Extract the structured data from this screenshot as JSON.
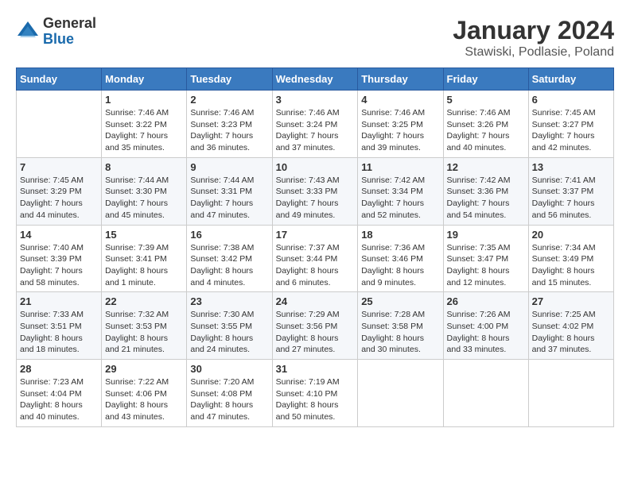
{
  "logo": {
    "general": "General",
    "blue": "Blue"
  },
  "title": {
    "month_year": "January 2024",
    "location": "Stawiski, Podlasie, Poland"
  },
  "days_of_week": [
    "Sunday",
    "Monday",
    "Tuesday",
    "Wednesday",
    "Thursday",
    "Friday",
    "Saturday"
  ],
  "weeks": [
    [
      {
        "day": "",
        "info": ""
      },
      {
        "day": "1",
        "info": "Sunrise: 7:46 AM\nSunset: 3:22 PM\nDaylight: 7 hours\nand 35 minutes."
      },
      {
        "day": "2",
        "info": "Sunrise: 7:46 AM\nSunset: 3:23 PM\nDaylight: 7 hours\nand 36 minutes."
      },
      {
        "day": "3",
        "info": "Sunrise: 7:46 AM\nSunset: 3:24 PM\nDaylight: 7 hours\nand 37 minutes."
      },
      {
        "day": "4",
        "info": "Sunrise: 7:46 AM\nSunset: 3:25 PM\nDaylight: 7 hours\nand 39 minutes."
      },
      {
        "day": "5",
        "info": "Sunrise: 7:46 AM\nSunset: 3:26 PM\nDaylight: 7 hours\nand 40 minutes."
      },
      {
        "day": "6",
        "info": "Sunrise: 7:45 AM\nSunset: 3:27 PM\nDaylight: 7 hours\nand 42 minutes."
      }
    ],
    [
      {
        "day": "7",
        "info": "Sunrise: 7:45 AM\nSunset: 3:29 PM\nDaylight: 7 hours\nand 44 minutes."
      },
      {
        "day": "8",
        "info": "Sunrise: 7:44 AM\nSunset: 3:30 PM\nDaylight: 7 hours\nand 45 minutes."
      },
      {
        "day": "9",
        "info": "Sunrise: 7:44 AM\nSunset: 3:31 PM\nDaylight: 7 hours\nand 47 minutes."
      },
      {
        "day": "10",
        "info": "Sunrise: 7:43 AM\nSunset: 3:33 PM\nDaylight: 7 hours\nand 49 minutes."
      },
      {
        "day": "11",
        "info": "Sunrise: 7:42 AM\nSunset: 3:34 PM\nDaylight: 7 hours\nand 52 minutes."
      },
      {
        "day": "12",
        "info": "Sunrise: 7:42 AM\nSunset: 3:36 PM\nDaylight: 7 hours\nand 54 minutes."
      },
      {
        "day": "13",
        "info": "Sunrise: 7:41 AM\nSunset: 3:37 PM\nDaylight: 7 hours\nand 56 minutes."
      }
    ],
    [
      {
        "day": "14",
        "info": "Sunrise: 7:40 AM\nSunset: 3:39 PM\nDaylight: 7 hours\nand 58 minutes."
      },
      {
        "day": "15",
        "info": "Sunrise: 7:39 AM\nSunset: 3:41 PM\nDaylight: 8 hours\nand 1 minute."
      },
      {
        "day": "16",
        "info": "Sunrise: 7:38 AM\nSunset: 3:42 PM\nDaylight: 8 hours\nand 4 minutes."
      },
      {
        "day": "17",
        "info": "Sunrise: 7:37 AM\nSunset: 3:44 PM\nDaylight: 8 hours\nand 6 minutes."
      },
      {
        "day": "18",
        "info": "Sunrise: 7:36 AM\nSunset: 3:46 PM\nDaylight: 8 hours\nand 9 minutes."
      },
      {
        "day": "19",
        "info": "Sunrise: 7:35 AM\nSunset: 3:47 PM\nDaylight: 8 hours\nand 12 minutes."
      },
      {
        "day": "20",
        "info": "Sunrise: 7:34 AM\nSunset: 3:49 PM\nDaylight: 8 hours\nand 15 minutes."
      }
    ],
    [
      {
        "day": "21",
        "info": "Sunrise: 7:33 AM\nSunset: 3:51 PM\nDaylight: 8 hours\nand 18 minutes."
      },
      {
        "day": "22",
        "info": "Sunrise: 7:32 AM\nSunset: 3:53 PM\nDaylight: 8 hours\nand 21 minutes."
      },
      {
        "day": "23",
        "info": "Sunrise: 7:30 AM\nSunset: 3:55 PM\nDaylight: 8 hours\nand 24 minutes."
      },
      {
        "day": "24",
        "info": "Sunrise: 7:29 AM\nSunset: 3:56 PM\nDaylight: 8 hours\nand 27 minutes."
      },
      {
        "day": "25",
        "info": "Sunrise: 7:28 AM\nSunset: 3:58 PM\nDaylight: 8 hours\nand 30 minutes."
      },
      {
        "day": "26",
        "info": "Sunrise: 7:26 AM\nSunset: 4:00 PM\nDaylight: 8 hours\nand 33 minutes."
      },
      {
        "day": "27",
        "info": "Sunrise: 7:25 AM\nSunset: 4:02 PM\nDaylight: 8 hours\nand 37 minutes."
      }
    ],
    [
      {
        "day": "28",
        "info": "Sunrise: 7:23 AM\nSunset: 4:04 PM\nDaylight: 8 hours\nand 40 minutes."
      },
      {
        "day": "29",
        "info": "Sunrise: 7:22 AM\nSunset: 4:06 PM\nDaylight: 8 hours\nand 43 minutes."
      },
      {
        "day": "30",
        "info": "Sunrise: 7:20 AM\nSunset: 4:08 PM\nDaylight: 8 hours\nand 47 minutes."
      },
      {
        "day": "31",
        "info": "Sunrise: 7:19 AM\nSunset: 4:10 PM\nDaylight: 8 hours\nand 50 minutes."
      },
      {
        "day": "",
        "info": ""
      },
      {
        "day": "",
        "info": ""
      },
      {
        "day": "",
        "info": ""
      }
    ]
  ]
}
